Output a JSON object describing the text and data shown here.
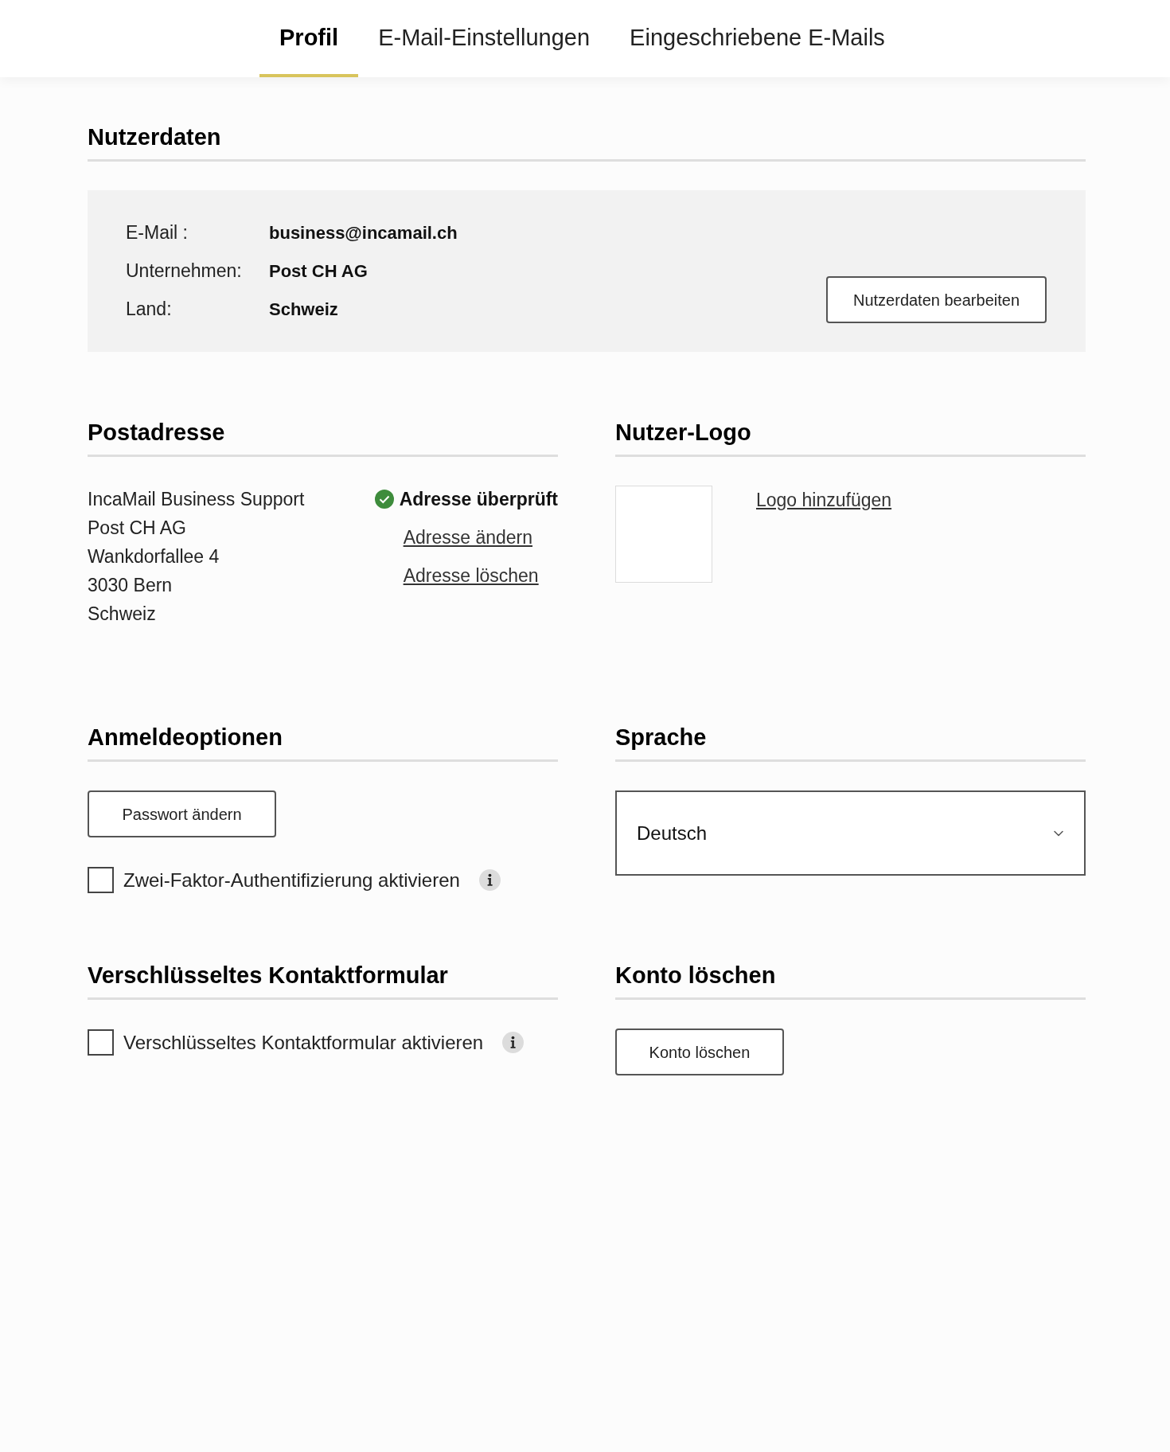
{
  "tabs": [
    {
      "label": "Profil",
      "selected": true
    },
    {
      "label": "E-Mail-Einstellungen",
      "selected": false
    },
    {
      "label": "Eingeschriebene E-Mails",
      "selected": false
    }
  ],
  "user_data": {
    "title": "Nutzerdaten",
    "fields": [
      {
        "label": "E-Mail :",
        "value": "business@incamail.ch"
      },
      {
        "label": "Unternehmen:",
        "value": "Post CH AG"
      },
      {
        "label": "Land:",
        "value": "Schweiz"
      }
    ],
    "button": "Nutzerdaten bearbeiten"
  },
  "postal_address": {
    "title": "Postadresse",
    "lines": [
      "IncaMail Business Support",
      "Post CH AG",
      "Wankdorfallee 4",
      "3030 Bern",
      "Schweiz"
    ],
    "status": "Adresse überprüft",
    "links": [
      "Adresse ändern",
      "Adresse löschen"
    ]
  },
  "user_logo": {
    "title": "Nutzer-Logo",
    "link": "Logo hinzufügen"
  },
  "login_options": {
    "title": "Anmeldeoptionen",
    "button": "Passwort ändern",
    "checkbox": {
      "label": "Zwei-Faktor-Authentifizierung aktivieren",
      "checked": false
    }
  },
  "language": {
    "title": "Sprache",
    "value": "Deutsch"
  },
  "contact_form": {
    "title": "Verschlüsseltes Kontaktformular",
    "checkbox": {
      "label": "Verschlüsseltes Kontaktformular aktivieren",
      "checked": false
    }
  },
  "delete_account": {
    "title": "Konto löschen",
    "button": "Konto löschen"
  }
}
